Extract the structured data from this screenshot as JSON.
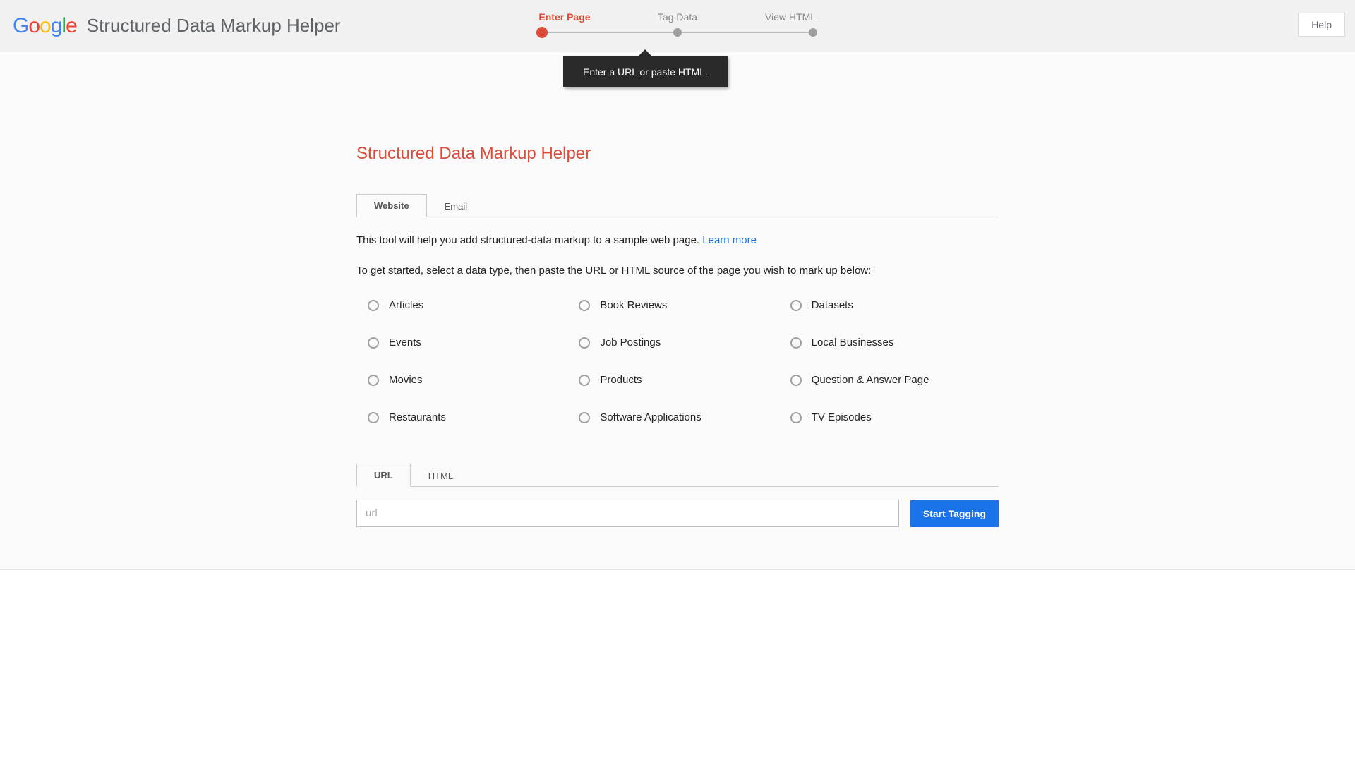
{
  "header": {
    "app_title": "Structured Data Markup Helper",
    "help_label": "Help"
  },
  "stepper": {
    "steps": [
      "Enter Page",
      "Tag Data",
      "View HTML"
    ],
    "active_index": 0
  },
  "tooltip": {
    "text": "Enter a URL or paste HTML."
  },
  "main": {
    "title": "Structured Data Markup Helper",
    "tabs": [
      {
        "label": "Website",
        "active": true
      },
      {
        "label": "Email",
        "active": false
      }
    ],
    "intro_text": "This tool will help you add structured-data markup to a sample web page. ",
    "learn_more": "Learn more",
    "instruction": "To get started, select a data type, then paste the URL or HTML source of the page you wish to mark up below:",
    "data_types": [
      "Articles",
      "Book Reviews",
      "Datasets",
      "Events",
      "Job Postings",
      "Local Businesses",
      "Movies",
      "Products",
      "Question & Answer Page",
      "Restaurants",
      "Software Applications",
      "TV Episodes"
    ],
    "input_tabs": [
      {
        "label": "URL",
        "active": true
      },
      {
        "label": "HTML",
        "active": false
      }
    ],
    "url_placeholder": "url",
    "start_button": "Start Tagging"
  }
}
